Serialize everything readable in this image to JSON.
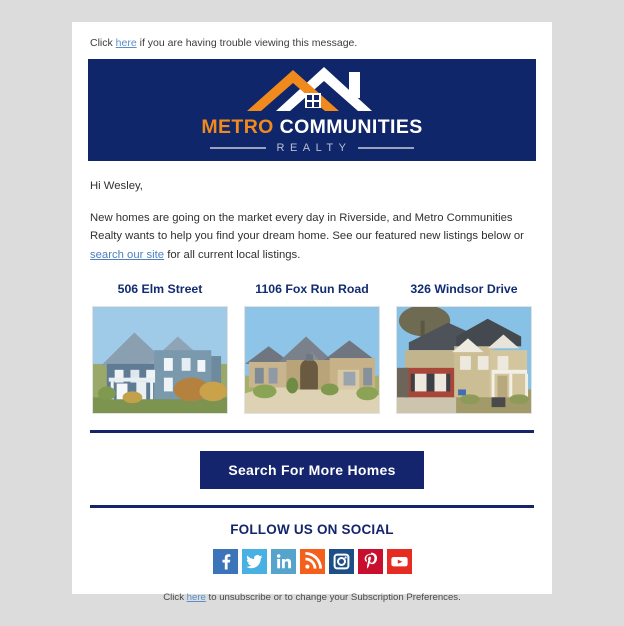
{
  "page": {
    "background_color": "#dcdcdc",
    "card_background": "#ffffff"
  },
  "preheader": {
    "text_before": "Click ",
    "link": "here",
    "text_after": " if you are having trouble viewing this message."
  },
  "brand": {
    "name_part1": "METRO",
    "name_part2": "COMMUNITIES",
    "tagline": "REALTY",
    "banner_color": "#10266b",
    "accent_color": "#f08a1c",
    "roof_white": "#ffffff"
  },
  "body": {
    "greeting": "Hi Wesley,",
    "intro_part1": "New homes are going on the market every day in Riverside, and Metro Communities Realty wants to help you find your dream home. See our featured new listings below or ",
    "intro_link": "search our site",
    "intro_part2": " for all current local listings."
  },
  "listings": [
    {
      "title": "506 Elm Street",
      "photo_alt": "two-story blue-gray sided house with covered front porch"
    },
    {
      "title": "1106 Fox Run Road",
      "photo_alt": "tan brick and stone house with multiple gables and arched entry"
    },
    {
      "title": "326 Windsor Drive",
      "photo_alt": "red brick house with tan siding, dormers and front porch"
    }
  ],
  "cta": {
    "label": "Search For More Homes",
    "color": "#14256d"
  },
  "social": {
    "heading": "FOLLOW US ON SOCIAL",
    "items": [
      {
        "name": "facebook",
        "label": "Facebook",
        "color": "#3b74b8"
      },
      {
        "name": "twitter",
        "label": "Twitter",
        "color": "#48b0e3"
      },
      {
        "name": "linkedin",
        "label": "LinkedIn",
        "color": "#56a3cc"
      },
      {
        "name": "rss",
        "label": "RSS",
        "color": "#f4601c"
      },
      {
        "name": "instagram",
        "label": "Instagram",
        "color": "#1d4f86"
      },
      {
        "name": "pinterest",
        "label": "Pinterest",
        "color": "#c8102e"
      },
      {
        "name": "youtube",
        "label": "YouTube",
        "color": "#e52b22"
      }
    ]
  },
  "footer": {
    "text_before": "Click ",
    "link": "here",
    "text_after": " to unsubscribe or to change your Subscription Preferences."
  }
}
